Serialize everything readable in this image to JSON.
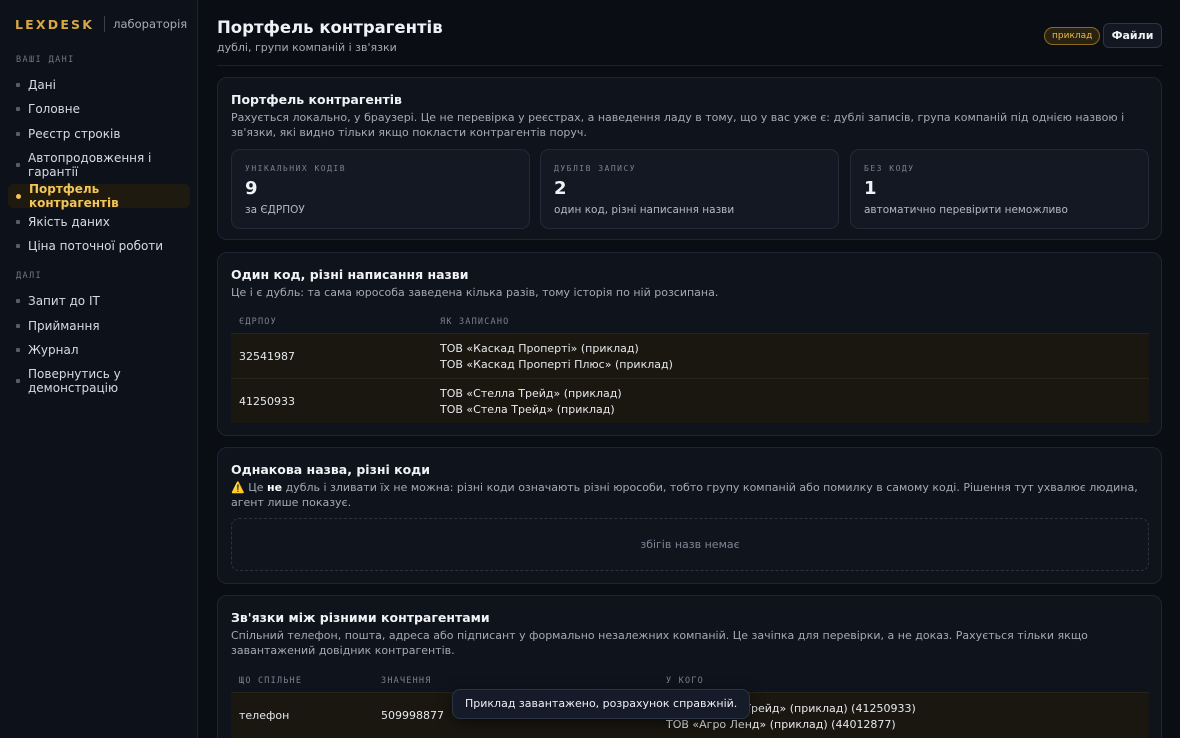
{
  "brand": {
    "logo": "LEXDESK",
    "subtitle": "лабораторія"
  },
  "sidebar": {
    "section1": "ВАШІ ДАНІ",
    "section1_items": [
      {
        "label": "Дані"
      },
      {
        "label": "Головне"
      },
      {
        "label": "Реєстр строків"
      },
      {
        "label": "Автопродовження і гарантії"
      },
      {
        "label": "Портфель контрагентів",
        "active": true
      },
      {
        "label": "Якість даних"
      },
      {
        "label": "Ціна поточної роботи"
      }
    ],
    "section2": "ДАЛІ",
    "section2_items": [
      {
        "label": "Запит до IT"
      },
      {
        "label": "Приймання"
      },
      {
        "label": "Журнал"
      },
      {
        "label": "Повернутись у демонстрацію"
      }
    ]
  },
  "header": {
    "title": "Портфель контрагентів",
    "subtitle": "дублі, групи компаній і зв'язки",
    "badge": "приклад",
    "files_button": "Файли"
  },
  "overview": {
    "title": "Портфель контрагентів",
    "description": "Рахується локально, у браузері. Це не перевірка у реєстрах, а наведення ладу в тому, що у вас уже є: дублі записів, група компаній під однією назвою і зв'язки, які видно тільки якщо покласти контрагентів поруч.",
    "stats": [
      {
        "label": "УНІКАЛЬНИХ КОДІВ",
        "value": "9",
        "note": "за ЄДРПОУ"
      },
      {
        "label": "ДУБЛІВ ЗАПИСУ",
        "value": "2",
        "note": "один код, різні написання назви"
      },
      {
        "label": "БЕЗ КОДУ",
        "value": "1",
        "note": "автоматично перевірити неможливо"
      }
    ]
  },
  "duplicates": {
    "title": "Один код, різні написання назви",
    "description": "Це і є дубль: та сама юрособа заведена кілька разів, тому історія по ній розсипана.",
    "columns": [
      "ЄДРПОУ",
      "ЯК ЗАПИСАНО"
    ],
    "rows": [
      {
        "code": "32541987",
        "names": [
          "ТОВ «Каскад Проперті» (приклад)",
          "ТОВ «Каскад Проперті Плюс» (приклад)"
        ]
      },
      {
        "code": "41250933",
        "names": [
          "ТОВ «Стелла Трейд» (приклад)",
          "ТОВ «Стела Трейд» (приклад)"
        ]
      }
    ]
  },
  "same_name": {
    "title": "Однакова назва, різні коди",
    "warning_icon": "⚠️",
    "desc_before": "Це ",
    "desc_bold": "не",
    "desc_after": " дубль і зливати їх не можна: різні коди означають різні юрособи, тобто групу компаній або помилку в самому коді. Рішення тут ухвалює людина, агент лише показує.",
    "empty_text": "збігів назв немає"
  },
  "links": {
    "title": "Зв'язки між різними контрагентами",
    "description": "Спільний телефон, пошта, адреса або підписант у формально незалежних компаній. Це зачіпка для перевірки, а не доказ. Рахується тільки якщо завантажений довідник контрагентів.",
    "columns": [
      "ЩО СПІЛЬНЕ",
      "ЗНАЧЕННЯ",
      "У КОГО"
    ],
    "rows": [
      {
        "what": "телефон",
        "value": "509998877",
        "who": [
          "ТОВ «Стелла Трейд» (приклад) (41250933)",
          "ТОВ «Агро Ленд» (приклад) (44012877)"
        ]
      }
    ]
  },
  "toast": "Приклад завантажено, розрахунок справжній."
}
